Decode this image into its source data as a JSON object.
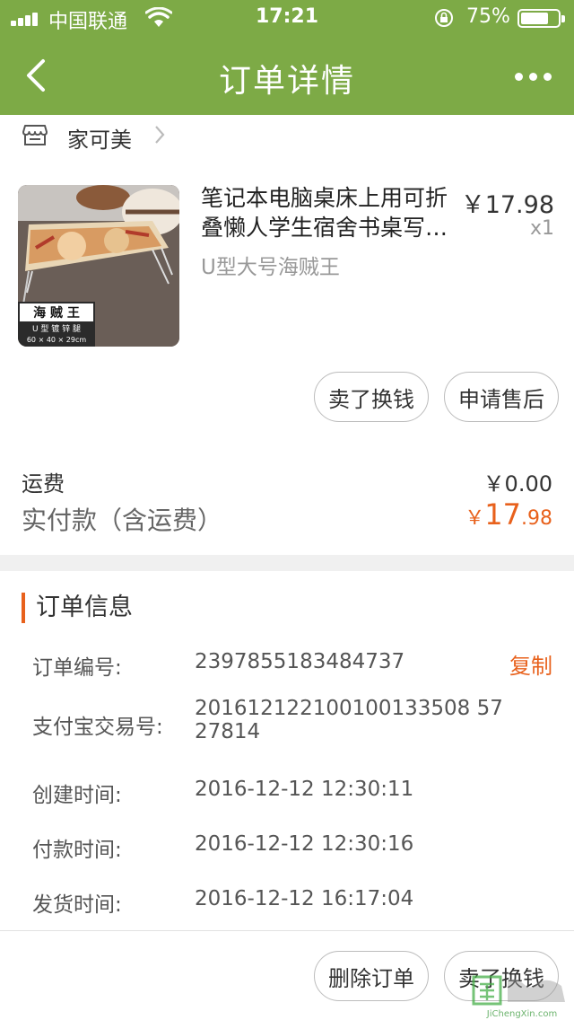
{
  "status_bar": {
    "carrier": "中国联通",
    "time": "17:21",
    "battery": "75%",
    "battery_level": 0.75
  },
  "nav": {
    "title": "订单详情",
    "back_icon": "chevron-left-icon",
    "more_icon": "more-dots-icon"
  },
  "shop": {
    "name": "家可美",
    "icon": "store-icon"
  },
  "product": {
    "title_line1": "笔记本电脑桌床上用可折",
    "title_line2": "叠懒人学生宿舍书桌写…",
    "price": "￥17.98",
    "quantity": "x1",
    "spec": "U型大号海贼王",
    "image_caption": "海 贼 王",
    "image_caption2": "U 型 镀 锌 腿",
    "image_caption3": "60 × 40 × 29cm"
  },
  "product_actions": {
    "sell": "卖了换钱",
    "after_sale": "申请售后"
  },
  "costs": {
    "shipping_label": "运费",
    "shipping_value": "￥0.00",
    "paid_label": "实付款（含运费）",
    "paid_currency": "￥",
    "paid_integer": "17",
    "paid_decimal": ".98"
  },
  "order_info": {
    "section_title": "订单信息",
    "order_no_label": "订单编号:",
    "order_no": "2397855183484737",
    "copy": "复制",
    "alipay_label": "支付宝交易号:",
    "alipay_line1": "201612122100100133508 57",
    "alipay_line2": "27814",
    "created_label": "创建时间:",
    "created": "2016-12-12 12:30:11",
    "paid_label": "付款时间:",
    "paid": "2016-12-12 12:30:16",
    "shipped_label": "发货时间:",
    "shipped": "2016-12-12 16:17:04"
  },
  "bottom_actions": {
    "delete": "删除订单",
    "sell": "卖了换钱"
  },
  "watermark": {
    "text": "JiChengXin.com"
  },
  "colors": {
    "header": "#7daa46",
    "accent": "#e8611c"
  }
}
